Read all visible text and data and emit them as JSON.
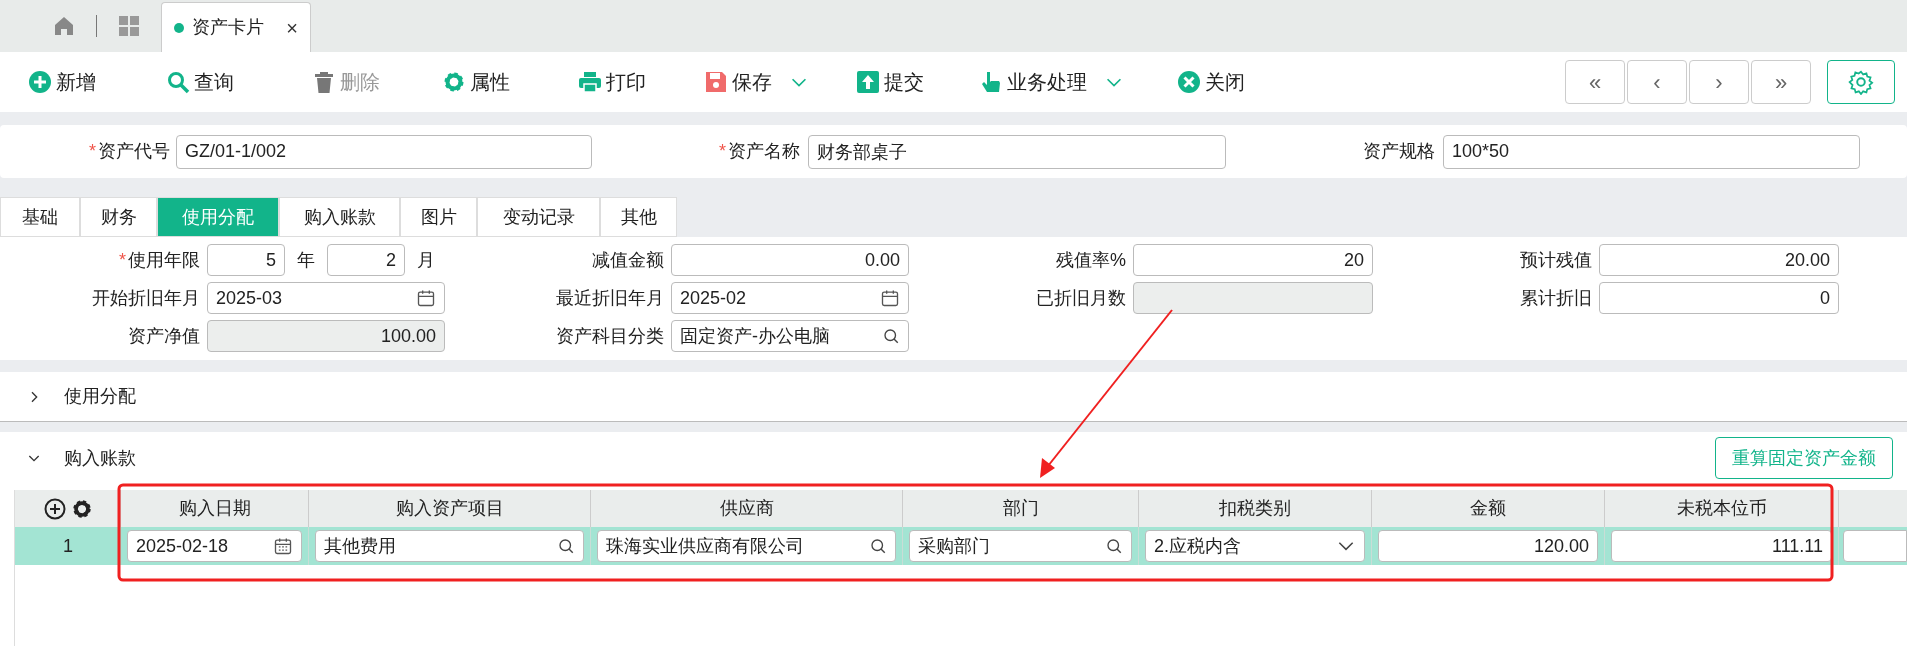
{
  "tab_bar": {
    "home_tab": {
      "kind": "home"
    },
    "apps_tab": {
      "kind": "grid"
    },
    "page_tab": {
      "label": "资产卡片",
      "selected": true,
      "close": "×"
    }
  },
  "toolbar": {
    "buttons": [
      {
        "label": "新增",
        "kind": "add",
        "disabled": false,
        "dropdown": false
      },
      {
        "label": "查询",
        "kind": "search",
        "disabled": false,
        "dropdown": false
      },
      {
        "label": "删除",
        "kind": "delete",
        "disabled": true,
        "dropdown": false
      },
      {
        "label": "属性",
        "kind": "gear",
        "disabled": false,
        "dropdown": false
      },
      {
        "label": "打印",
        "kind": "print",
        "disabled": false,
        "dropdown": false
      },
      {
        "label": "保存",
        "kind": "save",
        "disabled": false,
        "dropdown": true
      },
      {
        "label": "提交",
        "kind": "submit",
        "disabled": false,
        "dropdown": false
      },
      {
        "label": "业务处理",
        "kind": "hand",
        "disabled": false,
        "dropdown": true
      },
      {
        "label": "关闭",
        "kind": "close",
        "disabled": false,
        "dropdown": false
      }
    ],
    "pager": [
      "«",
      "‹",
      "›",
      "»"
    ]
  },
  "header_fields": [
    {
      "label": "资产代号",
      "required_mark": "*",
      "value": "GZ/01-1/002"
    },
    {
      "label": "资产名称",
      "required_mark": "*",
      "value": "财务部桌子"
    },
    {
      "label": "资产规格",
      "value": "100*50"
    }
  ],
  "tabs": [
    {
      "label": "基础",
      "selected": false
    },
    {
      "label": "财务",
      "selected": false
    },
    {
      "label": "使用分配",
      "selected": true
    },
    {
      "label": "购入账款",
      "selected": false
    },
    {
      "label": "图片",
      "selected": false
    },
    {
      "label": "变动记录",
      "selected": false
    },
    {
      "label": "其他",
      "selected": false
    }
  ],
  "form_fields": [
    {
      "label": "使用年限",
      "required_mark": "*",
      "kind": "term",
      "years": "5",
      "year_unit": "年",
      "months": "2",
      "month_unit": "月"
    },
    {
      "label": "减值金额",
      "kind": "number",
      "value": "0.00"
    },
    {
      "label": "残值率%",
      "kind": "number",
      "value": "20"
    },
    {
      "label": "预计残值",
      "kind": "number",
      "value": "20.00"
    },
    {
      "label": "开始折旧年月",
      "kind": "date",
      "value": "2025-03"
    },
    {
      "label": "最近折旧年月",
      "kind": "date",
      "value": "2025-02"
    },
    {
      "label": "已折旧月数",
      "kind": "readonly"
    },
    {
      "label": "累计折旧",
      "kind": "number",
      "value": "0"
    },
    {
      "label": "资产净值",
      "kind": "readonly",
      "value": "100.00"
    },
    {
      "label": "资产科目分类",
      "kind": "lookup",
      "value": "固定资产-办公电脑"
    }
  ],
  "sections": [
    {
      "label": "使用分配",
      "expanded": false
    },
    {
      "label": "购入账款",
      "expanded": true,
      "action": "重算固定资产金额"
    }
  ],
  "table": {
    "columns": [
      "购入日期",
      "购入资产项目",
      "供应商",
      "部门",
      "扣税类别",
      "金额",
      "未税本位币"
    ],
    "rows": [
      {
        "index": "1",
        "selected": true,
        "cells": [
          {
            "kind": "date",
            "value": "2025-02-18"
          },
          {
            "kind": "lookup",
            "value": "其他费用"
          },
          {
            "kind": "lookup",
            "value": "珠海实业供应商有限公司"
          },
          {
            "kind": "lookup",
            "value": "采购部门"
          },
          {
            "kind": "select",
            "value": "2.应税内含"
          },
          {
            "kind": "number",
            "value": "120.00"
          },
          {
            "kind": "number",
            "value": "111.11"
          }
        ]
      }
    ]
  }
}
